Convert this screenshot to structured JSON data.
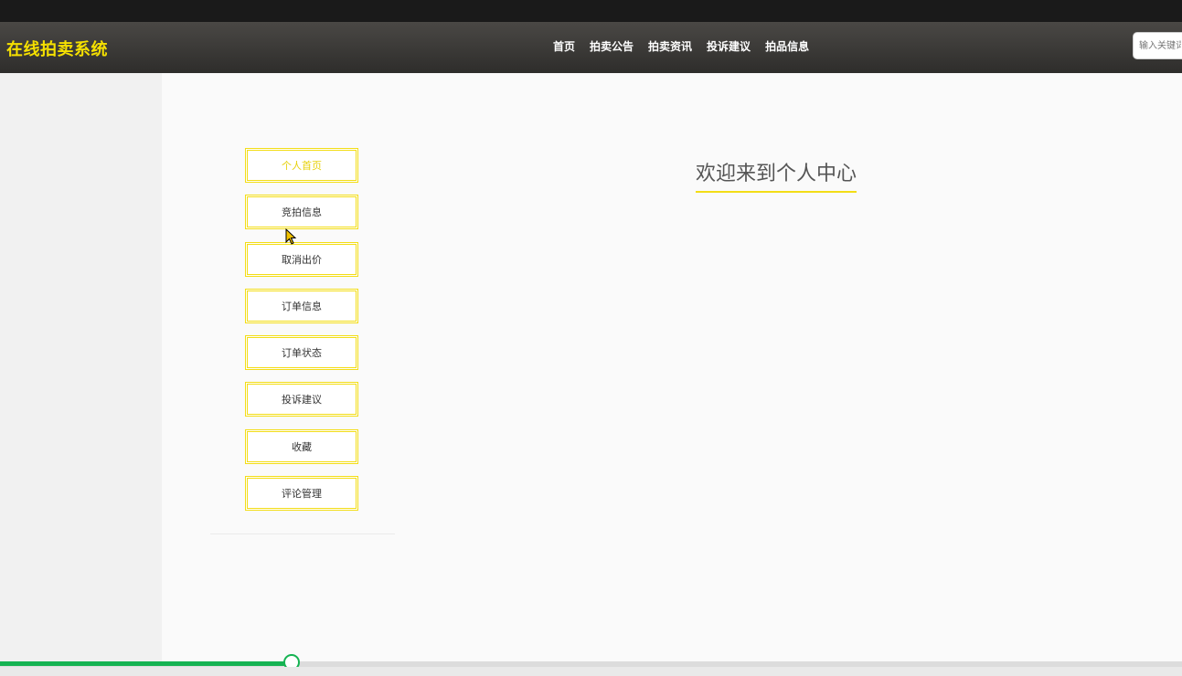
{
  "header": {
    "logo": "在线拍卖系统",
    "nav": [
      "首页",
      "拍卖公告",
      "拍卖资讯",
      "投诉建议",
      "拍品信息"
    ],
    "search_placeholder": "输入关键词"
  },
  "sidebar": {
    "items": [
      {
        "label": "个人首页",
        "active": true
      },
      {
        "label": "竞拍信息",
        "active": false
      },
      {
        "label": "取消出价",
        "active": false
      },
      {
        "label": "订单信息",
        "active": false
      },
      {
        "label": "订单状态",
        "active": false
      },
      {
        "label": "投诉建议",
        "active": false
      },
      {
        "label": "收藏",
        "active": false
      },
      {
        "label": "评论管理",
        "active": false
      }
    ]
  },
  "main": {
    "welcome_title": "欢迎来到个人中心"
  },
  "playback": {
    "progress_fraction": 0.248
  },
  "colors": {
    "accent": "#f3dd16",
    "logo": "#f5e000",
    "progress": "#15b352"
  }
}
